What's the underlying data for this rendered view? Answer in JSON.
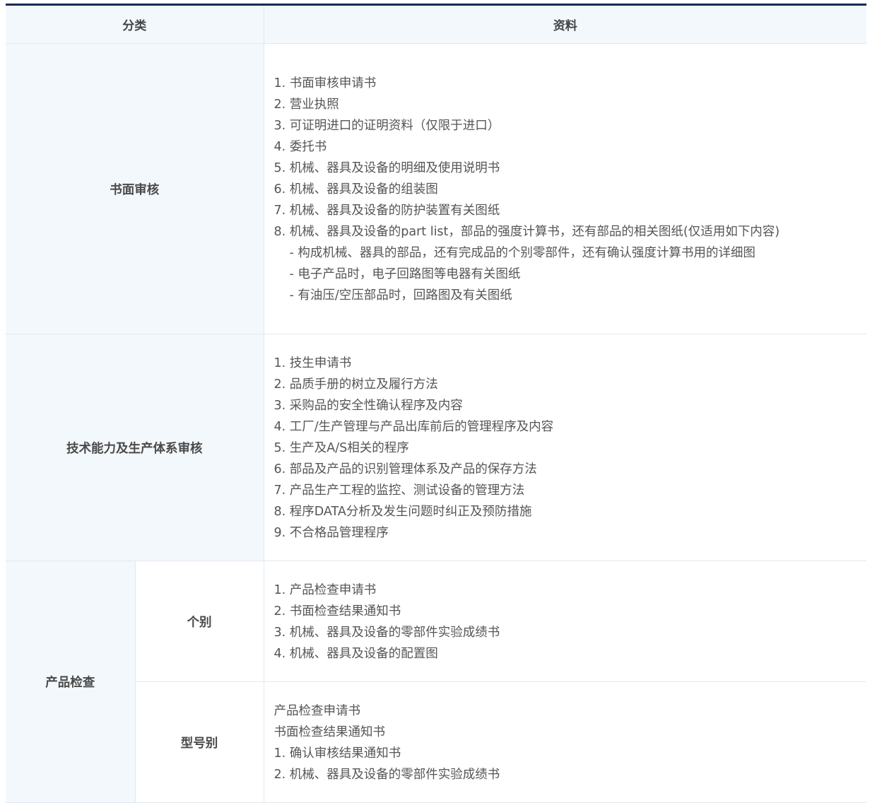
{
  "header": {
    "col_category": "分类",
    "col_docs": "资料"
  },
  "rows": {
    "written_review": {
      "category": "书面审核",
      "items": [
        "1. 书面审核申请书",
        "2. 营业执照",
        "3. 可证明进口的证明资料（仅限于进口）",
        "4. 委托书",
        "5. 机械、器具及设备的明细及使用说明书",
        "6. 机械、器具及设备的组装图",
        "7. 机械、器具及设备的防护装置有关图纸",
        "8. 机械、器具及设备的part list，部品的强度计算书，还有部品的相关图纸(仅适用如下内容)",
        "- 构成机械、器具的部品，还有完成品的个别零部件，还有确认强度计算书用的详细图",
        "- 电子产品时，电子回路图等电器有关图纸",
        "- 有油压/空压部品时，回路图及有关图纸"
      ]
    },
    "tech_review": {
      "category": "技术能力及生产体系审核",
      "items": [
        "1. 技生申请书",
        "2. 品质手册的树立及履行方法",
        "3. 采购品的安全性确认程序及内容",
        "4. 工厂/生产管理与产品出库前后的管理程序及内容",
        "5. 生产及A/S相关的程序",
        "6. 部品及产品的识别管理体系及产品的保存方法",
        "7. 产品生产工程的监控、测试设备的管理方法",
        "8. 程序DATA分析及发生问题时纠正及预防措施",
        "9. 不合格品管理程序"
      ]
    },
    "product_inspection": {
      "category": "产品检查",
      "individual": {
        "label": "个别",
        "items": [
          "1. 产品检查申请书",
          "2. 书面检查结果通知书",
          "3. 机械、器具及设备的零部件实验成绩书",
          "4. 机械、器具及设备的配置图"
        ]
      },
      "by_model": {
        "label": "型号别",
        "items": [
          "产品检查申请书",
          "书面检查结果通知书",
          "1. 确认审核结果通知书",
          "2. 机械、器具及设备的零部件实验成绩书"
        ]
      }
    }
  }
}
